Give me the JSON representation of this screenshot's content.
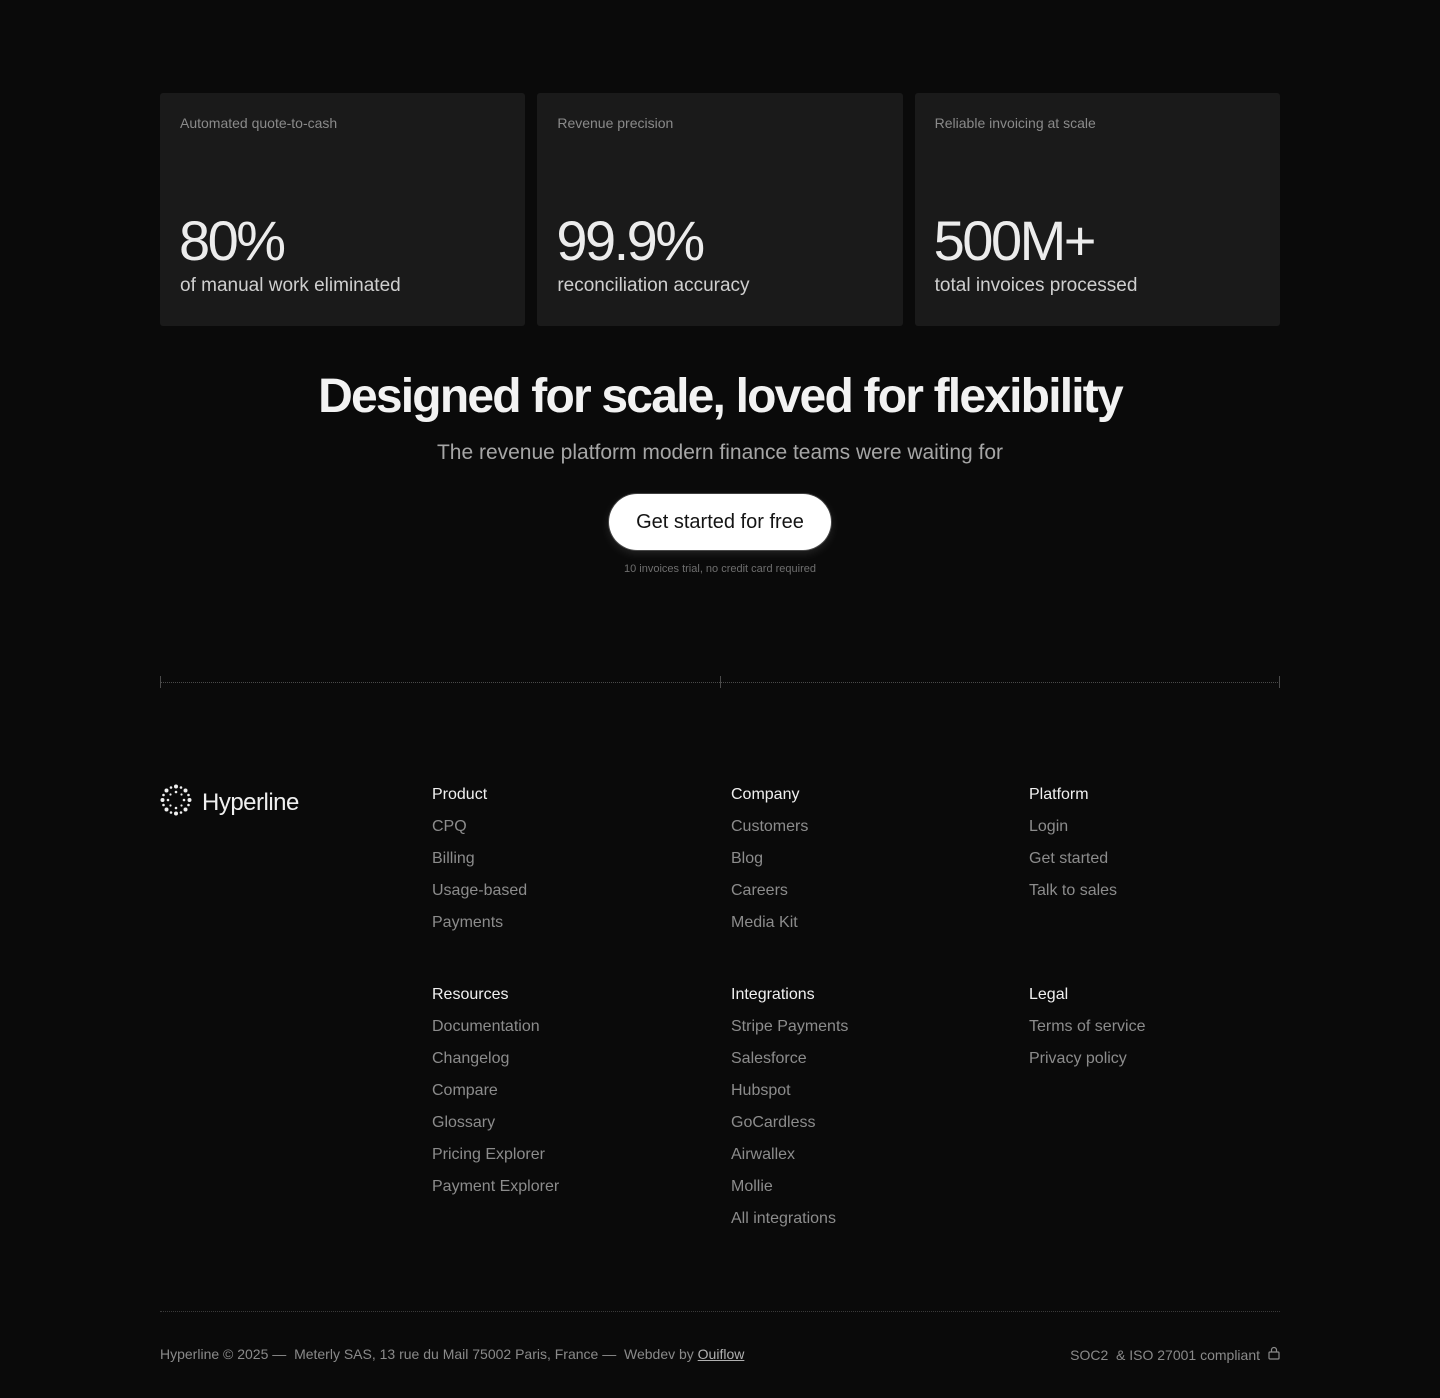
{
  "stats": [
    {
      "caption": "Automated quote-to-cash",
      "value": "80%",
      "desc": "of manual work eliminated"
    },
    {
      "caption": "Revenue precision",
      "value": "99.9%",
      "desc": "reconciliation accuracy"
    },
    {
      "caption": "Reliable invoicing at scale",
      "value": "500M+",
      "desc": "total invoices processed"
    }
  ],
  "hero": {
    "title": "Designed for scale, loved for flexibility",
    "subtitle": "The revenue platform modern finance teams were waiting for",
    "cta_label": "Get started for free",
    "cta_note": "10 invoices trial, no credit card required"
  },
  "brand": {
    "name": "Hyperline",
    "icon": "hyperline-logo-icon"
  },
  "footer": {
    "product": {
      "title": "Product",
      "links": [
        "CPQ",
        "Billing",
        "Usage-based",
        "Payments"
      ]
    },
    "company": {
      "title": "Company",
      "links": [
        "Customers",
        "Blog",
        "Careers",
        "Media Kit"
      ]
    },
    "platform": {
      "title": "Platform",
      "links": [
        "Login",
        "Get started",
        "Talk to sales"
      ]
    },
    "resources": {
      "title": "Resources",
      "links": [
        "Documentation",
        "Changelog",
        "Compare",
        "Glossary",
        "Pricing Explorer",
        "Payment Explorer"
      ]
    },
    "integrations": {
      "title": "Integrations",
      "links": [
        "Stripe Payments",
        "Salesforce",
        "Hubspot",
        "GoCardless",
        "Airwallex",
        "Mollie",
        "All integrations"
      ]
    },
    "legal": {
      "title": "Legal",
      "links": [
        "Terms of service",
        "Privacy policy"
      ]
    }
  },
  "bottom": {
    "copyright": "Hyperline © 2025 —",
    "address": "Meterly SAS, 13 rue du Mail 75002 Paris, France —",
    "webdev_prefix": "Webdev by",
    "webdev_link": "Ouiflow",
    "compliance": "SOC2  & ISO 27001 compliant",
    "compliance_icon": "lock-icon"
  },
  "colors": {
    "background": "#0a0a0a",
    "card": "#1a1a1a",
    "cta_bg": "#ffffff"
  }
}
